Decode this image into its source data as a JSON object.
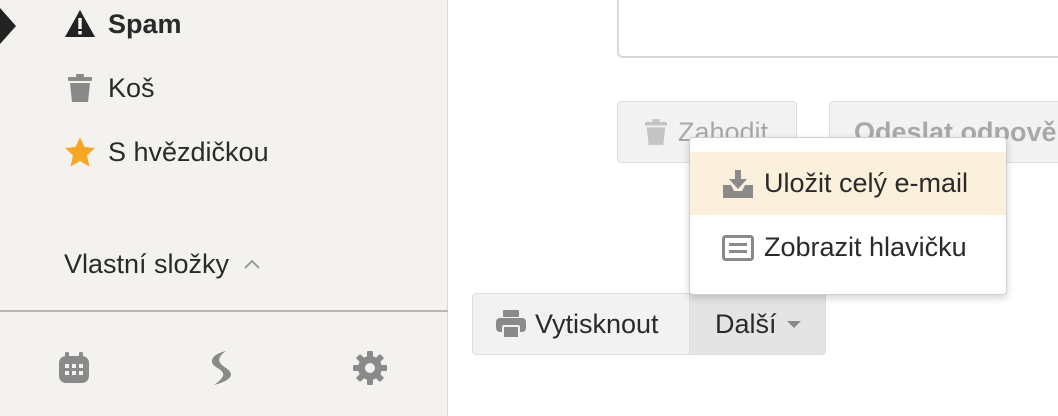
{
  "sidebar": {
    "folders": [
      {
        "label": "Spam",
        "icon": "warning-icon",
        "active": true
      },
      {
        "label": "Koš",
        "icon": "trash-icon"
      },
      {
        "label": "S hvězdičkou",
        "icon": "star-icon"
      }
    ],
    "custom_folders_label": "Vlastní složky",
    "bottom_icons": [
      "calendar-icon",
      "s-logo-icon",
      "gear-icon"
    ]
  },
  "compose": {
    "discard_label": "Zahodit",
    "send_label": "Odeslat odpově"
  },
  "toolbar": {
    "print_label": "Vytisknout",
    "more_label": "Další"
  },
  "more_menu": {
    "items": [
      {
        "label": "Uložit celý e-mail",
        "icon": "download-tray-icon",
        "highlighted": true
      },
      {
        "label": "Zobrazit hlavičku",
        "icon": "header-doc-icon"
      }
    ]
  },
  "colors": {
    "sidebar_bg": "#f4f2ee",
    "star": "#f5a623",
    "highlight": "#fbf0dc",
    "icon_gray": "#8a8a8a"
  }
}
